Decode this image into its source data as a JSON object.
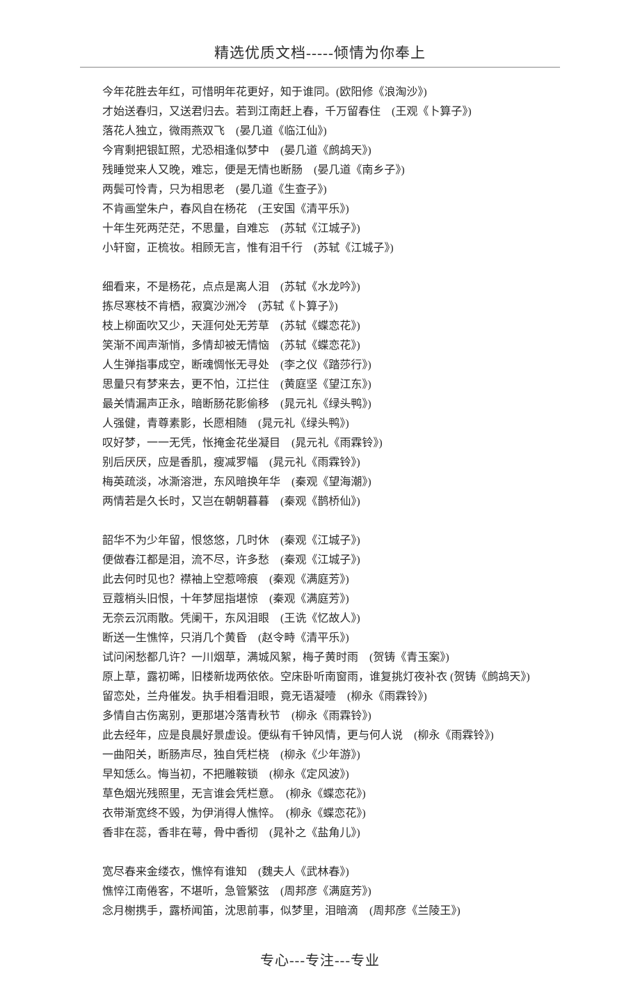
{
  "header": {
    "title": "精选优质文档-----倾情为你奉上"
  },
  "groups": [
    {
      "lines": [
        "今年花胜去年红，可惜明年花更好，知于谁同。(欧阳修《浪淘沙》)",
        "才始送春归，又送君归去。若到江南赶上春，千万留春住　(王观《卜算子》)",
        "落花人独立，微雨燕双飞　(晏几道《临江仙》)",
        "今宵剩把银缸照，尤恐相逢似梦中　(晏几道《鹧鸪天》)",
        "残睡觉来人又晚，难忘，便是无情也断肠　(晏几道《南乡子》)",
        "两鬓可怜青，只为相思老　(晏几道《生查子》)",
        "不肯画堂朱户，春风自在杨花　(王安国《清平乐》)",
        "十年生死两茫茫，不思量，自难忘　(苏轼《江城子》)",
        "小轩窗，正梳妆。相顾无言，惟有泪千行　(苏轼《江城子》)"
      ]
    },
    {
      "lines": [
        "细看来，不是杨花，点点是离人泪　(苏轼《水龙吟》)",
        "拣尽寒枝不肯栖，寂寞沙洲冷　(苏轼《卜算子》)",
        "枝上柳面吹又少，天涯何处无芳草　(苏轼《蝶恋花》)",
        "笑渐不闻声渐悄，多情却被无情恼　(苏轼《蝶恋花》)",
        "人生弹指事成空，断魂惆怅无寻处　(李之仪《踏莎行》)",
        "思量只有梦来去，更不怕，江拦住　(黄庭坚《望江东》)",
        "最关情漏声正永，暗断肠花影偷移　(晁元礼《绿头鸭》)",
        "人强健，青尊素影，长愿相随　(晁元礼《绿头鸭》)",
        "叹好梦，一一无凭，怅掩金花坐凝目　(晁元礼《雨霖铃》)",
        "别后厌厌，应是香肌，瘦减罗幅　(晁元礼《雨霖铃》)",
        "梅英疏淡，冰澌溶泄，东风暗换年华　(秦观《望海潮》)",
        "两情若是久长时，又岂在朝朝暮暮　(秦观《鹊桥仙》)"
      ]
    },
    {
      "lines": [
        "韶华不为少年留，恨悠悠，几时休　(秦观《江城子》)",
        "便做春江都是泪，流不尽，许多愁　(秦观《江城子》)",
        "此去何时见也？襟袖上空惹啼痕　(秦观《满庭芳》)",
        "豆蔻梢头旧恨，十年梦屈指堪惊　(秦观《满庭芳》)",
        "无奈云沉雨散。凭阑干，东风泪眼　(王诜《忆故人》)",
        "断送一生憔悴，只消几个黄昏　(赵令畤《清平乐》)",
        "试问闲愁都几许？一川烟草，满城风絮，梅子黄时雨　(贺铸《青玉案》)",
        "原上草，露初晞，旧楼新垅两依依。空床卧听南窗雨，谁复挑灯夜补衣 (贺铸《鹧鸪天》)",
        "留恋处，兰舟催发。执手相看泪眼，竟无语凝噎　(柳永《雨霖铃》)",
        "多情自古伤离别，更那堪冷落青秋节　(柳永《雨霖铃》)",
        "此去经年，应是良晨好景虚设。便纵有千钟风情，更与何人说　(柳永《雨霖铃》)",
        "一曲阳关，断肠声尽，独自凭栏桡　(柳永《少年游》)",
        "早知恁么。悔当初，不把雕鞍锁　(柳永《定风波》)",
        "草色烟光残照里，无言谁会凭栏意。　(柳永《蝶恋花》)",
        "衣带渐宽终不毁，为伊消得人憔悴。　(柳永《蝶恋花》)",
        "香非在蕊，香非在萼，骨中香彻　(晁补之《盐角儿》)"
      ]
    },
    {
      "lines": [
        "宽尽春来金缕衣，憔悴有谁知　(魏夫人《武林春》)",
        "憔悴江南倦客，不堪听，急管繁弦　(周邦彦《满庭芳》)",
        "念月榭携手，露桥闻笛，沈思前事，似梦里，泪暗滴　(周邦彦《兰陵王》)"
      ]
    }
  ],
  "footer": {
    "text": "专心---专注---专业"
  }
}
